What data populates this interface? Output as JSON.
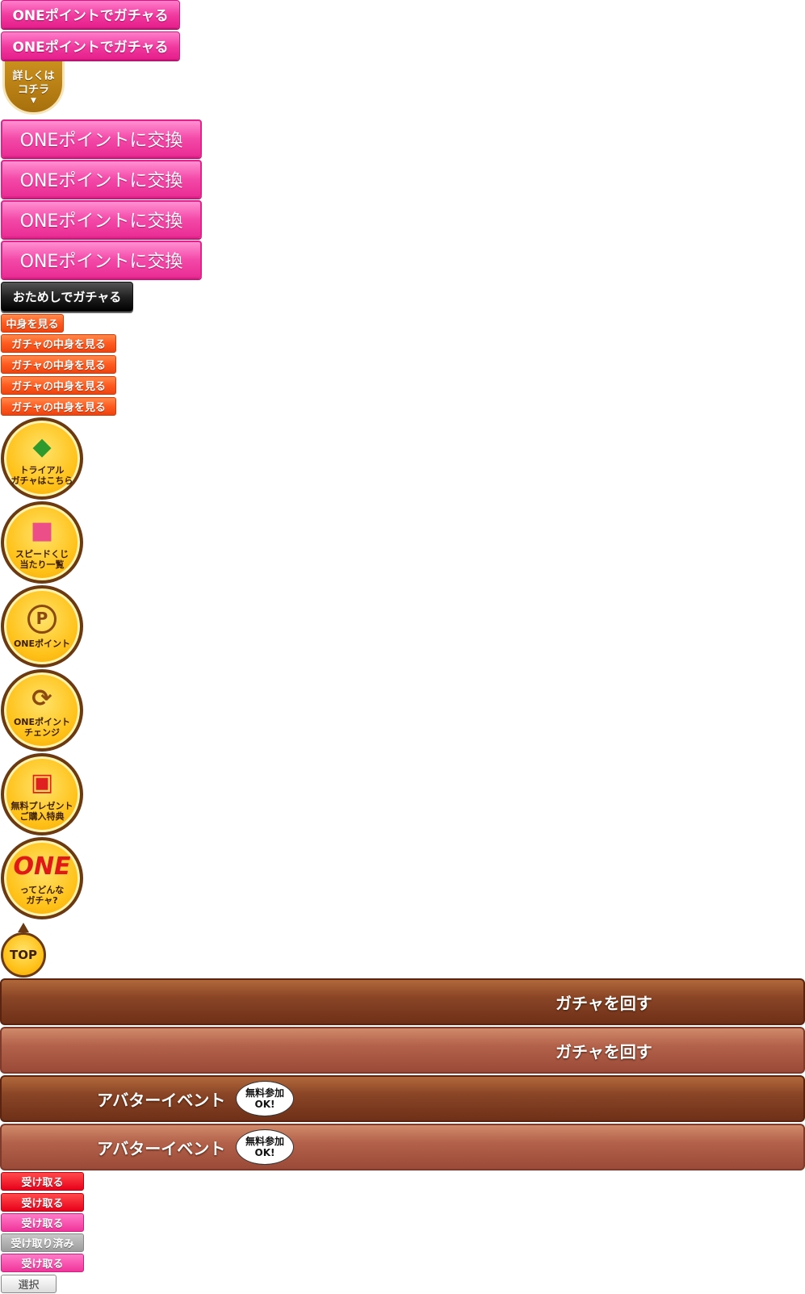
{
  "gacha_buttons": [
    "ONEポイントでガチャる",
    "ONEポイントでガチャる"
  ],
  "detail_badge": {
    "line1": "詳しくは",
    "line2": "コチラ",
    "arrow": "▼"
  },
  "exchange_buttons": [
    "ONEポイントに交換",
    "ONEポイントに交換",
    "ONEポイントに交換",
    "ONEポイントに交換"
  ],
  "trial_gacha_button": "おためしでガチャる",
  "view_buttons": [
    "中身を見る",
    "ガチャの中身を見る",
    "ガチャの中身を見る",
    "ガチャの中身を見る",
    "ガチャの中身を見る"
  ],
  "circle_menu": [
    {
      "icon": "beginner-leaf-icon",
      "glyph": "◆",
      "line1": "トライアル",
      "line2": "ガチャはこちら"
    },
    {
      "icon": "prize-box-icon",
      "glyph": "■",
      "line1": "スピードくじ",
      "line2": "当たり一覧"
    },
    {
      "icon": "point-coin-icon",
      "glyph": "P",
      "line1": "ONEポイント",
      "line2": ""
    },
    {
      "icon": "point-exchange-icon",
      "glyph": "⟳",
      "line1": "ONEポイント",
      "line2": "チェンジ"
    },
    {
      "icon": "gift-box-icon",
      "glyph": "▣",
      "line1": "無料プレゼント",
      "line2": "ご購入特典"
    },
    {
      "icon": "one-logo-icon",
      "glyph": "ONE",
      "line1": "ってどんな",
      "line2": "ガチャ?"
    }
  ],
  "top_button": "TOP",
  "spin_bars": [
    "ガチャを回す",
    "ガチャを回す"
  ],
  "event_bars": [
    {
      "label": "アバターイベント",
      "bubble1": "無料参加",
      "bubble2": "OK!"
    },
    {
      "label": "アバターイベント",
      "bubble1": "無料参加",
      "bubble2": "OK!"
    }
  ],
  "receive_buttons": [
    "受け取る",
    "受け取る",
    "受け取る",
    "受け取り済み",
    "受け取る"
  ],
  "select_button": "選択"
}
